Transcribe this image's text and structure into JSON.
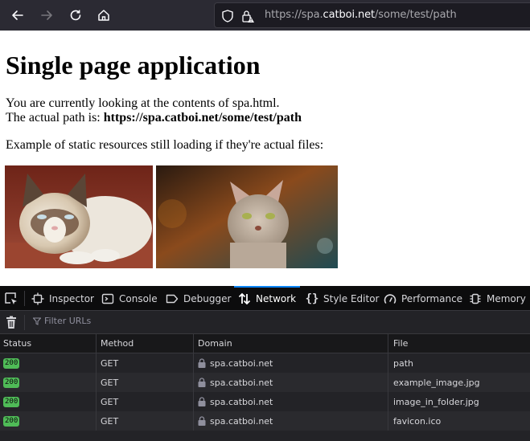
{
  "browser": {
    "url": {
      "scheme_prefix": "https://spa.",
      "host_highlight": "catboi.net",
      "path": "/some/test/path"
    },
    "icons": [
      "back-arrow-icon",
      "forward-arrow-icon",
      "reload-icon",
      "home-icon",
      "tracking-shield-icon",
      "insecure-lock-warning-icon"
    ]
  },
  "page": {
    "heading": "Single page application",
    "line1": "You are currently looking at the contents of spa.html.",
    "line2_prefix": "The actual path is: ",
    "line2_bold": "https://spa.catboi.net/some/test/path",
    "line3": "Example of static resources still loading if they're actual files:",
    "images": [
      {
        "alt": "grumpy cat lying on red cushion"
      },
      {
        "alt": "tabby cat with bokeh background"
      }
    ]
  },
  "devtools": {
    "tabs": [
      {
        "label": "Inspector",
        "icon": "inspector-icon"
      },
      {
        "label": "Console",
        "icon": "console-icon"
      },
      {
        "label": "Debugger",
        "icon": "debugger-icon"
      },
      {
        "label": "Network",
        "icon": "network-arrows-icon",
        "active": true
      },
      {
        "label": "Style Editor",
        "icon": "braces-icon"
      },
      {
        "label": "Performance",
        "icon": "gauge-icon"
      },
      {
        "label": "Memory",
        "icon": "chip-icon"
      }
    ],
    "filter_placeholder": "Filter URLs",
    "columns": [
      "Status",
      "Method",
      "Domain",
      "File"
    ],
    "requests": [
      {
        "status": "200",
        "method": "GET",
        "domain": "spa.catboi.net",
        "file": "path"
      },
      {
        "status": "200",
        "method": "GET",
        "domain": "spa.catboi.net",
        "file": "example_image.jpg"
      },
      {
        "status": "200",
        "method": "GET",
        "domain": "spa.catboi.net",
        "file": "image_in_folder.jpg"
      },
      {
        "status": "200",
        "method": "GET",
        "domain": "spa.catboi.net",
        "file": "favicon.ico"
      }
    ],
    "colors": {
      "status_ok": "#4fbb57",
      "active_tab": "#0a84ff"
    }
  }
}
